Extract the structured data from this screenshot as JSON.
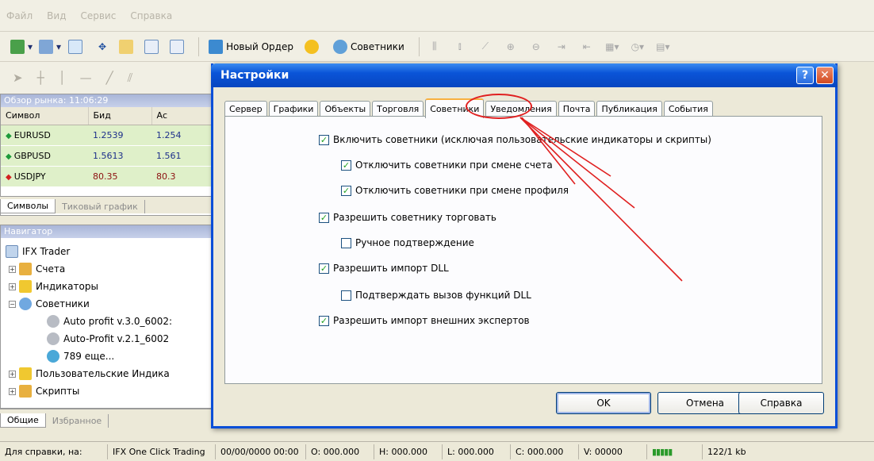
{
  "menubar": {
    "items": [
      "Файл",
      "Вид",
      "Сервис",
      "Справка"
    ]
  },
  "toolbar": {
    "new_order_label": "Новый Ордер",
    "experts_label": "Советники"
  },
  "market_watch": {
    "caption": "Обзор рынка: 11:06:29",
    "columns": [
      "Символ",
      "Бид",
      "Ас"
    ],
    "rows": [
      {
        "symbol": "EURUSD",
        "bid": "1.2539",
        "ask": "1.254",
        "direction": "up"
      },
      {
        "symbol": "GBPUSD",
        "bid": "1.5613",
        "ask": "1.561",
        "direction": "up"
      },
      {
        "symbol": "USDJPY",
        "bid": "80.35",
        "ask": "80.3",
        "direction": "down"
      }
    ],
    "tabs": [
      "Символы",
      "Тиковый график"
    ]
  },
  "navigator": {
    "caption": "Навигатор",
    "root": "IFX Trader",
    "nodes": [
      {
        "label": "Счета",
        "expander": "+"
      },
      {
        "label": "Индикаторы",
        "expander": "+"
      },
      {
        "label": "Советники",
        "expander": "−"
      },
      {
        "label": "Auto profit v.3.0_6002:",
        "child": true
      },
      {
        "label": "Auto-Profit v.2.1_6002",
        "child": true
      },
      {
        "label": "789 еще...",
        "child": true
      },
      {
        "label": "Пользовательские Индика",
        "expander": "+"
      },
      {
        "label": "Скрипты",
        "expander": "+"
      }
    ],
    "tabs": [
      "Общие",
      "Избранное"
    ]
  },
  "dialog": {
    "title": "Настройки",
    "help_glyph": "?",
    "close_glyph": "✕",
    "tabs": [
      "Сервер",
      "Графики",
      "Объекты",
      "Торговля",
      "Советники",
      "Уведомления",
      "Почта",
      "Публикация",
      "События"
    ],
    "active_tab": "Советники",
    "options": [
      {
        "label": "Включить советники (исключая пользовательские индикаторы и скрипты)",
        "checked": true
      },
      {
        "label": "Отключить советники при смене счета",
        "checked": true
      },
      {
        "label": "Отключить советники при смене профиля",
        "checked": true
      },
      {
        "label": "Разрешить советнику торговать",
        "checked": true
      },
      {
        "label": "Ручное подтверждение",
        "checked": false
      },
      {
        "label": "Разрешить импорт DLL",
        "checked": true
      },
      {
        "label": "Подтверждать вызов функций DLL",
        "checked": false
      },
      {
        "label": "Разрешить импорт внешних экспертов",
        "checked": true
      }
    ],
    "buttons": {
      "ok": "OK",
      "cancel": "Отмена",
      "help": "Справка"
    }
  },
  "statusbar": {
    "cells": [
      "Для справки, на:",
      "IFX One Click Trading",
      "00/00/0000 00:00",
      "O: 000.000",
      "H: 000.000",
      "L: 000.000",
      "C: 000.000",
      "V: 00000",
      "122/1 kb"
    ]
  },
  "colors": {
    "title_blue": "#0a54d8",
    "market_green": "#dff0c9",
    "annotation_red": "#e02020"
  }
}
